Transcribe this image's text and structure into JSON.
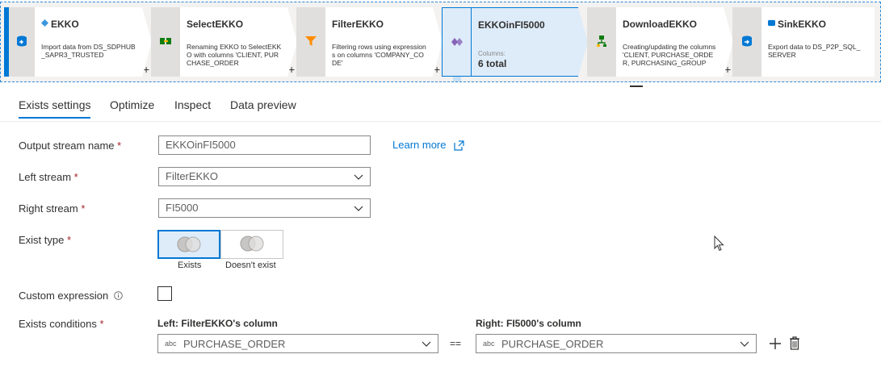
{
  "pipeline": [
    {
      "title": "EKKO",
      "desc": "Import data from DS_SDPHUB_SAPR3_TRUSTED",
      "icon": "source-icon"
    },
    {
      "title": "SelectEKKO",
      "desc": "Renaming EKKO to SelectEKKO with columns 'CLIENT, PURCHASE_ORDER",
      "icon": "select-icon"
    },
    {
      "title": "FilterEKKO",
      "desc": "Filtering rows using expressions on columns 'COMPANY_CODE'",
      "icon": "filter-icon"
    },
    {
      "title": "EKKOinFI5000",
      "columns_label": "Columns:",
      "columns_value": "6 total",
      "icon": "exists-icon"
    },
    {
      "title": "DownloadEKKO",
      "desc": "Creating/updating the columns 'CLIENT, PURCHASE_ORDER, PURCHASING_GROUP",
      "icon": "derive-icon"
    },
    {
      "title": "SinkEKKO",
      "desc": "Export data to DS_P2P_SQL_SERVER",
      "icon": "sink-icon"
    }
  ],
  "plus": "+",
  "tabs": [
    "Exists settings",
    "Optimize",
    "Inspect",
    "Data preview"
  ],
  "form": {
    "output_stream_label": "Output stream name",
    "output_stream_value": "EKKOinFI5000",
    "learn_more": "Learn more",
    "left_stream_label": "Left stream",
    "left_stream_value": "FilterEKKO",
    "right_stream_label": "Right stream",
    "right_stream_value": "FI5000",
    "exist_type_label": "Exist type",
    "exists_option": "Exists",
    "doesnt_exist_option": "Doesn't exist",
    "custom_expression_label": "Custom expression",
    "custom_expression_checked": false,
    "exists_conditions_label": "Exists conditions",
    "left_col_header": "Left: FilterEKKO's column",
    "right_col_header": "Right: FI5000's column",
    "left_col_type": "abc",
    "left_col_value": "PURCHASE_ORDER",
    "right_col_type": "abc",
    "right_col_value": "PURCHASE_ORDER",
    "operator": "==",
    "required_mark": "*"
  },
  "colors": {
    "accent": "#0078d4",
    "required": "#a4262c",
    "selected_bg": "#deecf9"
  }
}
